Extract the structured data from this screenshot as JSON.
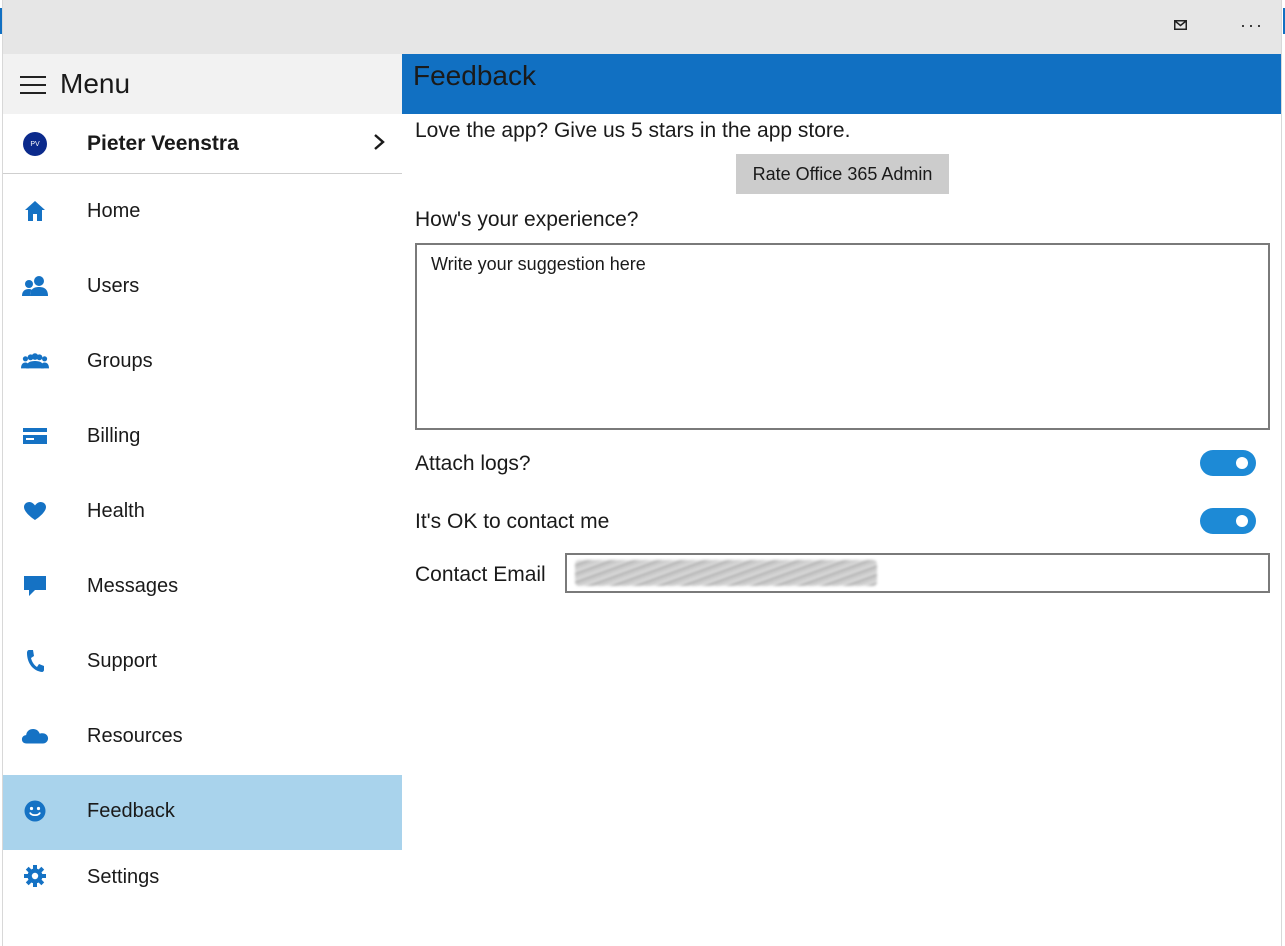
{
  "titlebar": {
    "mail_icon": "mail-icon",
    "more_label": "···"
  },
  "sidebar": {
    "menu_title": "Menu",
    "user": {
      "initials": "PV",
      "name": "Pieter Veenstra"
    },
    "items": [
      {
        "label": "Home",
        "icon": "home-icon"
      },
      {
        "label": "Users",
        "icon": "users-icon"
      },
      {
        "label": "Groups",
        "icon": "groups-icon"
      },
      {
        "label": "Billing",
        "icon": "credit-card-icon"
      },
      {
        "label": "Health",
        "icon": "heart-icon"
      },
      {
        "label": "Messages",
        "icon": "speech-bubble-icon"
      },
      {
        "label": "Support",
        "icon": "phone-icon"
      },
      {
        "label": "Resources",
        "icon": "cloud-icon"
      },
      {
        "label": "Feedback",
        "icon": "smiley-icon",
        "active": true
      },
      {
        "label": "Settings",
        "icon": "gear-icon"
      }
    ]
  },
  "main": {
    "page_title": "Feedback",
    "rate_prompt": "Love the app? Give us 5 stars in the app store.",
    "rate_button": "Rate Office 365 Admin",
    "experience_label": "How's your experience?",
    "suggestion_placeholder": "Write your suggestion here",
    "attach_logs_label": "Attach logs?",
    "attach_logs_on": true,
    "contact_ok_label": "It's OK to contact me",
    "contact_ok_on": true,
    "contact_email_label": "Contact Email"
  },
  "colors": {
    "accent": "#1170c2",
    "active_nav": "#a9d3ec",
    "toggle_on": "#1d8ad6",
    "icon_blue": "#1572c4"
  }
}
